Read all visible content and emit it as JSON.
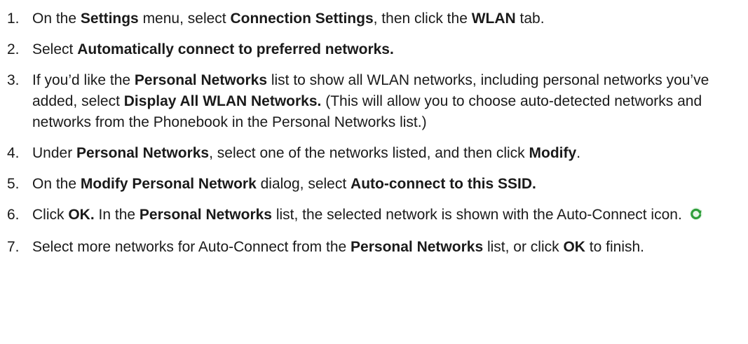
{
  "steps": [
    {
      "number": "1.",
      "parts": [
        {
          "t": "On the "
        },
        {
          "t": "Settings",
          "b": true
        },
        {
          "t": " menu, select "
        },
        {
          "t": "Connection Settings",
          "b": true
        },
        {
          "t": ", then click the "
        },
        {
          "t": "WLAN",
          "b": true
        },
        {
          "t": " tab."
        }
      ]
    },
    {
      "number": "2.",
      "parts": [
        {
          "t": "Select "
        },
        {
          "t": "Automatically connect to preferred networks.",
          "b": true
        }
      ]
    },
    {
      "number": "3.",
      "parts": [
        {
          "t": "If you’d like the "
        },
        {
          "t": "Personal Networks",
          "b": true
        },
        {
          "t": " list to show all WLAN networks, including personal networks you’ve added, select "
        },
        {
          "t": "Display All WLAN Networks.",
          "b": true
        },
        {
          "t": " (This will allow you to choose auto-detected networks and networks from the Phonebook in the Personal Networks list.)"
        }
      ]
    },
    {
      "number": "4.",
      "parts": [
        {
          "t": "Under "
        },
        {
          "t": "Personal Networks",
          "b": true
        },
        {
          "t": ", select one of the networks listed, and then click "
        },
        {
          "t": "Modify",
          "b": true
        },
        {
          "t": "."
        }
      ]
    },
    {
      "number": "5.",
      "parts": [
        {
          "t": "On the "
        },
        {
          "t": "Modify Personal Network",
          "b": true
        },
        {
          "t": " dialog, select "
        },
        {
          "t": "Auto-connect to this SSID.",
          "b": true
        }
      ]
    },
    {
      "number": "6.",
      "parts": [
        {
          "t": "Click "
        },
        {
          "t": "OK.",
          "b": true
        },
        {
          "t": " In the "
        },
        {
          "t": "Personal Networks",
          "b": true
        },
        {
          "t": " list, the selected network is shown with the Auto-Connect icon."
        }
      ],
      "icon": "auto-connect-icon"
    },
    {
      "number": "7.",
      "parts": [
        {
          "t": "Select more networks for Auto-Connect from the "
        },
        {
          "t": "Personal Networks",
          "b": true
        },
        {
          "t": " list, or click "
        },
        {
          "t": "OK",
          "b": true
        },
        {
          "t": " to finish."
        }
      ]
    }
  ],
  "colors": {
    "text": "#1a1a1a",
    "icon_green": "#2e9e3a"
  }
}
